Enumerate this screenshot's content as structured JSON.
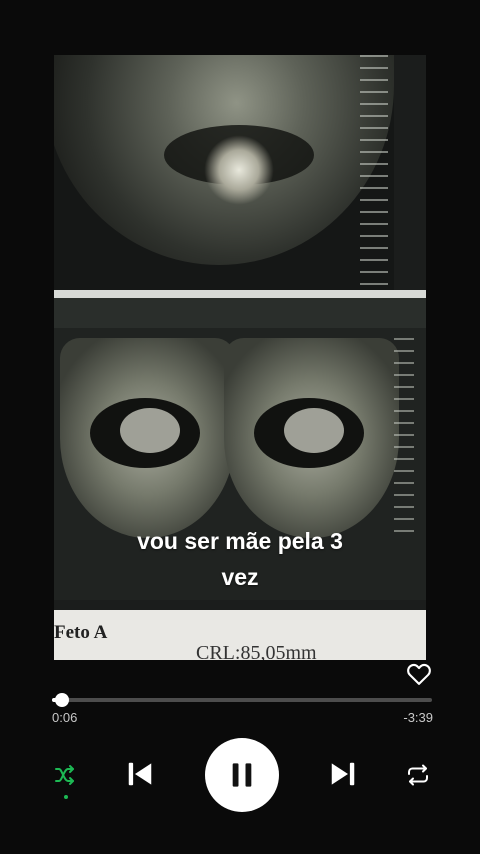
{
  "video": {
    "caption_line1": "vou ser mãe pela 3",
    "caption_line2": "vez",
    "paper_label": "Feto A",
    "paper_measure": "CRL:85,05mm"
  },
  "player": {
    "liked": false,
    "progress_fraction": 0.0275,
    "elapsed": "0:06",
    "remaining": "-3:39",
    "shuffle_active": true,
    "playing": true,
    "accent_color": "#1db954"
  },
  "icons": {
    "like": "heart-outline-icon",
    "shuffle": "shuffle-icon",
    "previous": "skip-previous-icon",
    "play_pause": "pause-icon",
    "next": "skip-next-icon",
    "repeat": "repeat-icon"
  }
}
